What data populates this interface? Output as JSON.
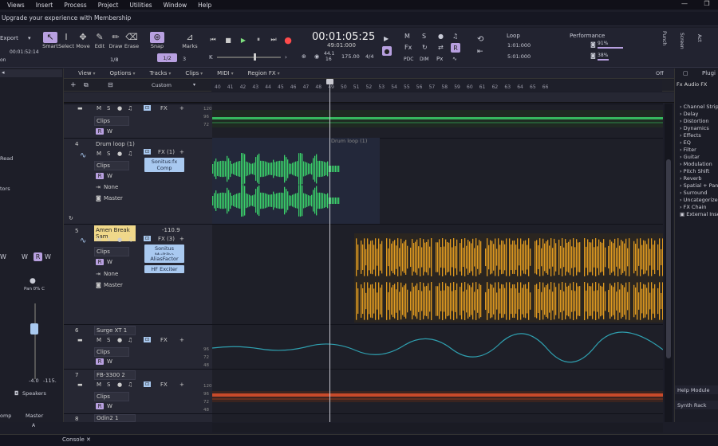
{
  "menu": {
    "items": [
      "Views",
      "Insert",
      "Process",
      "Project",
      "Utilities",
      "Window",
      "Help"
    ]
  },
  "upgrade": {
    "text": "Upgrade your experience with Membership"
  },
  "toolbar": {
    "export": "Export",
    "time_small": "00:01:52:14",
    "tools": [
      "Smart",
      "Select",
      "Move",
      "Edit",
      "Draw",
      "Erase"
    ],
    "quant": "1/8",
    "snap": "Snap",
    "snap_val": "1/2",
    "marks": "Marks",
    "marks_val": "3",
    "timecode": "00:01:05:25",
    "bars": "49:01:000",
    "bpm_top": "44.1",
    "bpm_bottom": "16",
    "tempo": "175.00",
    "meter": "4/4",
    "loop": "Loop",
    "loop_start": "1:01:000",
    "loop_end": "5:01:000",
    "perf": "Performance",
    "perf1": "91%",
    "perf2": "38%",
    "punch": "Punch",
    "screen": "Screen",
    "act": "Act"
  },
  "tracks_menu": {
    "items": [
      "View",
      "Options",
      "Tracks",
      "Clips",
      "MIDI",
      "Region FX"
    ],
    "custom": "Custom",
    "off": "Off"
  },
  "ruler": {
    "ticks": [
      "40",
      "41",
      "42",
      "43",
      "44",
      "45",
      "46",
      "47",
      "48",
      "49",
      "50",
      "51",
      "52",
      "53",
      "54",
      "55",
      "56",
      "57",
      "58",
      "59",
      "60",
      "61",
      "62",
      "63",
      "64",
      "65",
      "66"
    ]
  },
  "tracks": [
    {
      "num": "",
      "name": "",
      "clips": "Clips",
      "fx": "FX"
    },
    {
      "num": "4",
      "name": "Drum loop (1)",
      "clips": "Clips",
      "fx": "FX (1)",
      "plugins": [
        "Sonitus:fx Comp"
      ],
      "input": "None",
      "output": "Master",
      "clip_label": "Drum loop (1)"
    },
    {
      "num": "5",
      "name": "Amen Break Sam",
      "clips": "Clips",
      "fx": "FX (3)",
      "db": "-110.9",
      "plugins": [
        "Sonitus Multiba",
        "AliasFactor",
        "HF Exciter"
      ],
      "input": "None",
      "output": "Master"
    },
    {
      "num": "6",
      "name": "Surge XT 1",
      "clips": "Clips",
      "fx": "FX"
    },
    {
      "num": "7",
      "name": "FB-3300 2",
      "clips": "Clips",
      "fx": "FX"
    },
    {
      "num": "8",
      "name": "Odin2 1",
      "clips": "",
      "fx": ""
    }
  ],
  "browser": {
    "header": "Plugi",
    "tab": "Audio FX",
    "items": [
      "Channel Strip",
      "Delay",
      "Distortion",
      "Dynamics",
      "Effects",
      "EQ",
      "Filter",
      "Guitar",
      "Modulation",
      "Pitch Shift",
      "Reverb",
      "Spatial + Pano",
      "Surround",
      "Uncategorized",
      "FX Chain",
      "External Insert"
    ],
    "help": "Help Module",
    "synth": "Synth Rack"
  },
  "leftpanel": {
    "read": "Read",
    "tors": "tors",
    "pan": "Pan 0% C",
    "speakers": "Speakers",
    "val1": "-4.0",
    "val2": "-115.",
    "master": "Master",
    "comp": "omp",
    "a": "A"
  },
  "bottom": {
    "console": "Console"
  }
}
